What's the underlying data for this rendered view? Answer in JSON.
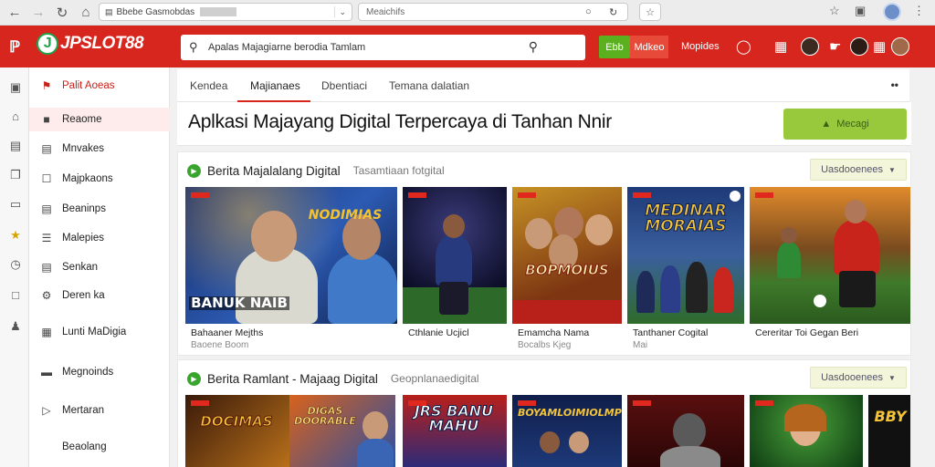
{
  "browser": {
    "url_text": "Bbebe Gasmobdas",
    "search_placeholder": "Meaichifs"
  },
  "header": {
    "logo_text": "JPSLOT88",
    "search_placeholder": "Apalas Majagiarne berodia Tamlam",
    "btn_green": "Ebb",
    "btn_red": "Mdkeo",
    "link": "Mopides"
  },
  "sidebar": {
    "items": [
      {
        "label": "Palit Aoeas",
        "icon": "flag-icon"
      },
      {
        "label": "Reaome",
        "icon": "square-icon"
      },
      {
        "label": "Mnvakes",
        "icon": "image-icon"
      },
      {
        "label": "Majpkaons",
        "icon": "box-icon"
      },
      {
        "label": "Beaninps",
        "icon": "doc-icon"
      },
      {
        "label": "Malepies",
        "icon": "list-icon"
      },
      {
        "label": "Senkan",
        "icon": "minus-icon"
      },
      {
        "label": "Deren ka",
        "icon": "gear-icon"
      },
      {
        "label": "Lunti MaDigia",
        "icon": "grid-icon"
      },
      {
        "label": "Megnoinds",
        "icon": "menu-icon"
      },
      {
        "label": "Mertaran",
        "icon": "puzzle-icon"
      },
      {
        "label": "Beaolang",
        "icon": "blank-icon"
      }
    ]
  },
  "tabs": [
    "Kendea",
    "Majianaes",
    "Dbentiaci",
    "Temana dalatian"
  ],
  "hero": {
    "title": "Aplkasi Majayang Digital Terpercaya di Tanhan Nnir",
    "button": "Mecagi"
  },
  "section1": {
    "title": "Berita Majalalang Digital",
    "subtitle": "Tasamtiaan fotgital",
    "dropdown": "Uasdooenees",
    "cards": [
      {
        "caption": "Bahaaner Mejths",
        "sub": "Baoene Boom",
        "banner": "NODIMIAS",
        "banner2": "BANUK NAIB",
        "theme": "blue"
      },
      {
        "caption": "Cthlanie Ucjicl",
        "sub": "",
        "banner": "",
        "banner2": "",
        "theme": "night"
      },
      {
        "caption": "Emamcha Nama",
        "sub": "Bocalbs Kjeg",
        "banner": "BOPMOIUS",
        "banner2": "",
        "theme": "gold"
      },
      {
        "caption": "Tanthaner Cogital",
        "sub": "Mai",
        "banner": "MEDINAR MORAIAS",
        "banner2": "",
        "theme": "team"
      },
      {
        "caption": "Cereritar Toi Gegan Beri",
        "sub": "",
        "banner": "",
        "banner2": "",
        "theme": "stadium"
      }
    ]
  },
  "section2": {
    "title": "Berita Ramlant - Majaag Digital",
    "subtitle": "Geopnlanaedigital",
    "dropdown": "Uasdooenees",
    "cards": [
      {
        "banner": "DOCIMAS",
        "theme": "gold2"
      },
      {
        "banner": "DIGAS DOORABLE",
        "theme": "orange"
      },
      {
        "banner": "JRS BANU MAHU",
        "theme": "blue2"
      },
      {
        "banner": "BOYAMLOIMIOLMP",
        "theme": "night2"
      },
      {
        "banner": "",
        "theme": "dark"
      },
      {
        "banner": "",
        "theme": "green"
      },
      {
        "banner": "BBY",
        "theme": "black"
      }
    ]
  }
}
